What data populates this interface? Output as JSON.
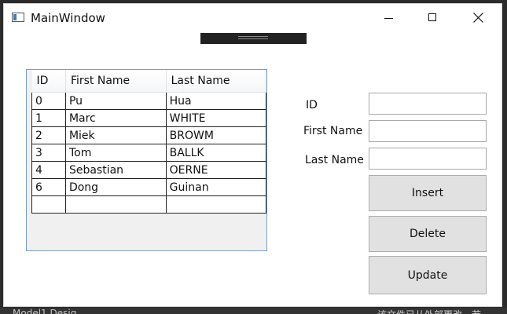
{
  "window": {
    "title": "MainWindow"
  },
  "grid": {
    "columns": [
      "ID",
      "First Name",
      "Last Name"
    ],
    "rows": [
      [
        "0",
        "Pu",
        "Hua"
      ],
      [
        "1",
        "Marc",
        "WHITE"
      ],
      [
        "2",
        "Miek",
        "BROWM"
      ],
      [
        "3",
        "Tom",
        "BALLK"
      ],
      [
        "4",
        "Sebastian",
        "OERNE"
      ],
      [
        "6",
        "Dong",
        "Guinan"
      ],
      [
        "",
        "",
        ""
      ]
    ]
  },
  "form": {
    "id_label": "ID",
    "first_name_label": "First Name",
    "last_name_label": "Last Name",
    "id_value": "",
    "first_name_value": "",
    "last_name_value": ""
  },
  "buttons": {
    "insert": "Insert",
    "delete": "Delete",
    "update": "Update"
  },
  "background": {
    "bottom_left": "Model1.Desig",
    "bottom_right": "该文件已从外部更改。若"
  },
  "icons": {
    "app": "window-app-icon",
    "minimize": "minimize-icon",
    "maximize": "maximize-icon",
    "close": "close-icon"
  }
}
